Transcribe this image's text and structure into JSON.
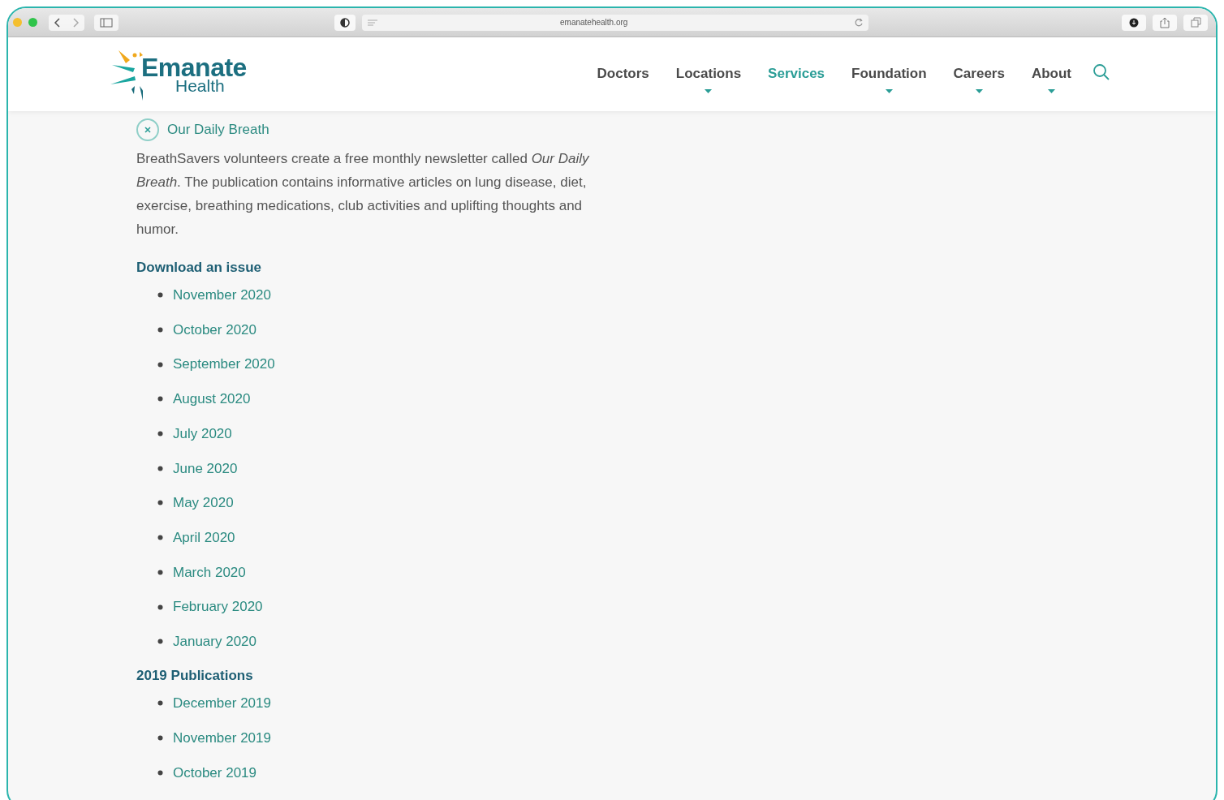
{
  "browser": {
    "url": "emanatehealth.org"
  },
  "logo": {
    "name": "Emanate",
    "tagline": "Health"
  },
  "nav": [
    {
      "label": "Doctors",
      "selected": false,
      "dropdown": false
    },
    {
      "label": "Locations",
      "selected": false,
      "dropdown": true
    },
    {
      "label": "Services",
      "selected": true,
      "dropdown": false
    },
    {
      "label": "Foundation",
      "selected": false,
      "dropdown": true
    },
    {
      "label": "Careers",
      "selected": false,
      "dropdown": true
    },
    {
      "label": "About",
      "selected": false,
      "dropdown": true
    }
  ],
  "section": {
    "title": "Our Daily Breath",
    "expanded": true,
    "text": "BreathSavers volunteers create a free monthly newsletter called *Our Daily Breath*. The publication contains informative articles on lung disease, diet, exercise, breathing medications, club activities and uplifting thoughts and humor."
  },
  "groups": [
    {
      "heading": "Download an issue",
      "items": [
        "November 2020",
        "October 2020",
        "September 2020",
        "August 2020",
        "July 2020",
        "June 2020",
        "May 2020",
        "April 2020",
        "March 2020",
        "February 2020",
        "January 2020"
      ]
    },
    {
      "heading": "2019 Publications",
      "items": [
        "December 2019",
        "November 2019",
        "October 2019"
      ]
    }
  ]
}
